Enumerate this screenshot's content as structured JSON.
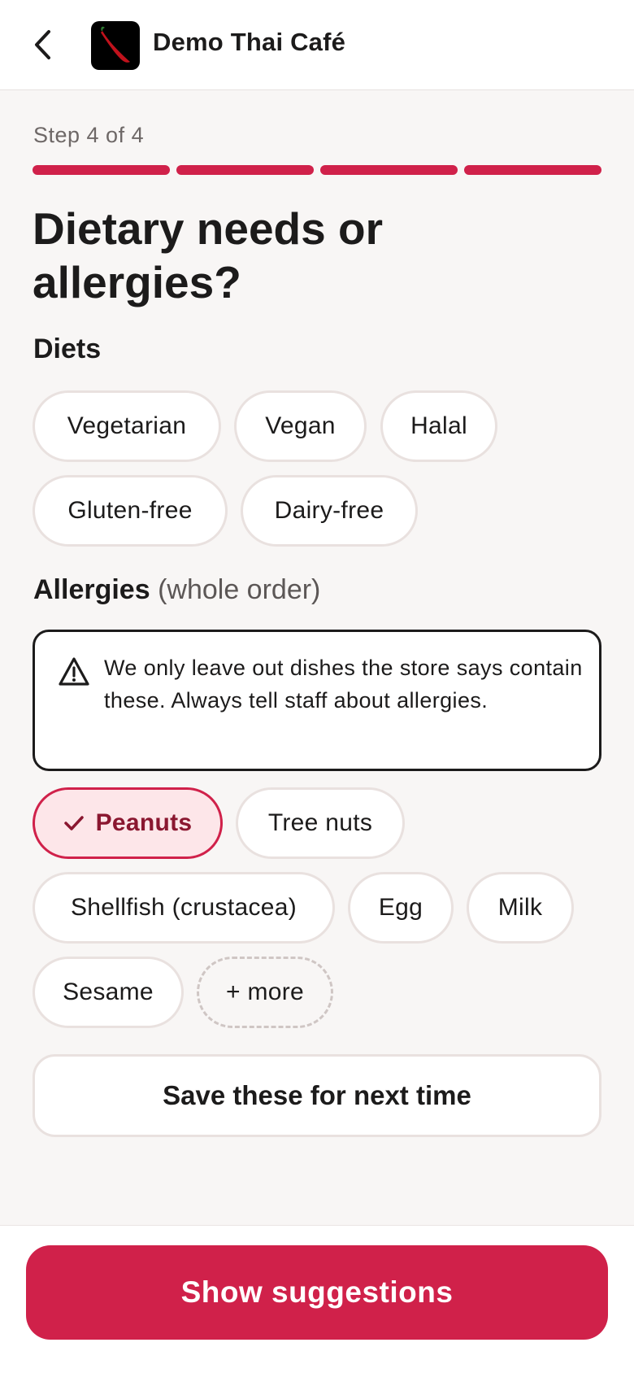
{
  "header": {
    "store_name": "Demo Thai Café",
    "back_icon": "chevron-left-icon",
    "logo_icon": "chili-pepper-logo"
  },
  "step": {
    "label": "Step 4 of 4",
    "current": 4,
    "total": 4,
    "color": "#d0214a"
  },
  "title": "Dietary needs or allergies?",
  "diets": {
    "label": "Diets",
    "options": [
      "Vegetarian",
      "Vegan",
      "Halal",
      "Gluten-free",
      "Dairy-free"
    ]
  },
  "allergies": {
    "label": "Allergies",
    "sublabel": "(whole order)",
    "notice": "We only leave out dishes the store says contain these. Always tell staff about allergies.",
    "notice_icon": "warning-triangle-icon",
    "options": [
      {
        "label": "Peanuts",
        "selected": true
      },
      {
        "label": "Tree nuts",
        "selected": false
      },
      {
        "label": "Shellfish (crustacea)",
        "selected": false
      },
      {
        "label": "Egg",
        "selected": false
      },
      {
        "label": "Milk",
        "selected": false
      },
      {
        "label": "Sesame",
        "selected": false
      }
    ],
    "more_label": "+ more"
  },
  "save_button": "Save these for next time",
  "cta_button": "Show suggestions",
  "colors": {
    "accent": "#d0214a",
    "selected_bg": "#fde6e9",
    "page_bg": "#f8f6f5"
  }
}
